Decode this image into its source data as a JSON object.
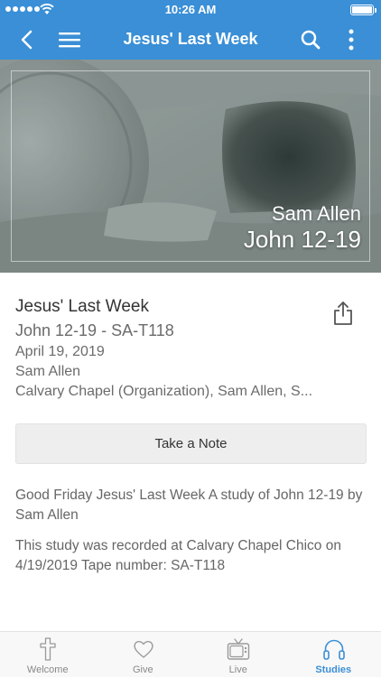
{
  "status": {
    "time": "10:26 AM"
  },
  "nav": {
    "title": "Jesus' Last Week"
  },
  "hero": {
    "speaker": "Sam Allen",
    "reference": "John 12-19"
  },
  "details": {
    "title": "Jesus' Last Week",
    "subtitle": "John 12-19 - SA-T118",
    "date": "April 19, 2019",
    "speaker": "Sam Allen",
    "organization": "Calvary Chapel (Organization), Sam Allen, S..."
  },
  "note_button": {
    "label": "Take a Note"
  },
  "description": {
    "paragraph1": "Good Friday Jesus' Last Week A study of John 12-19 by Sam Allen",
    "paragraph2": "This study was recorded at Calvary Chapel Chico on 4/19/2019 Tape number: SA-T118"
  },
  "tabs": [
    {
      "label": "Welcome",
      "icon": "cross-icon"
    },
    {
      "label": "Give",
      "icon": "heart-icon"
    },
    {
      "label": "Live",
      "icon": "tv-icon"
    },
    {
      "label": "Studies",
      "icon": "headphones-icon"
    }
  ],
  "colors": {
    "accent": "#3a8fd6",
    "tab_inactive": "#888888"
  }
}
